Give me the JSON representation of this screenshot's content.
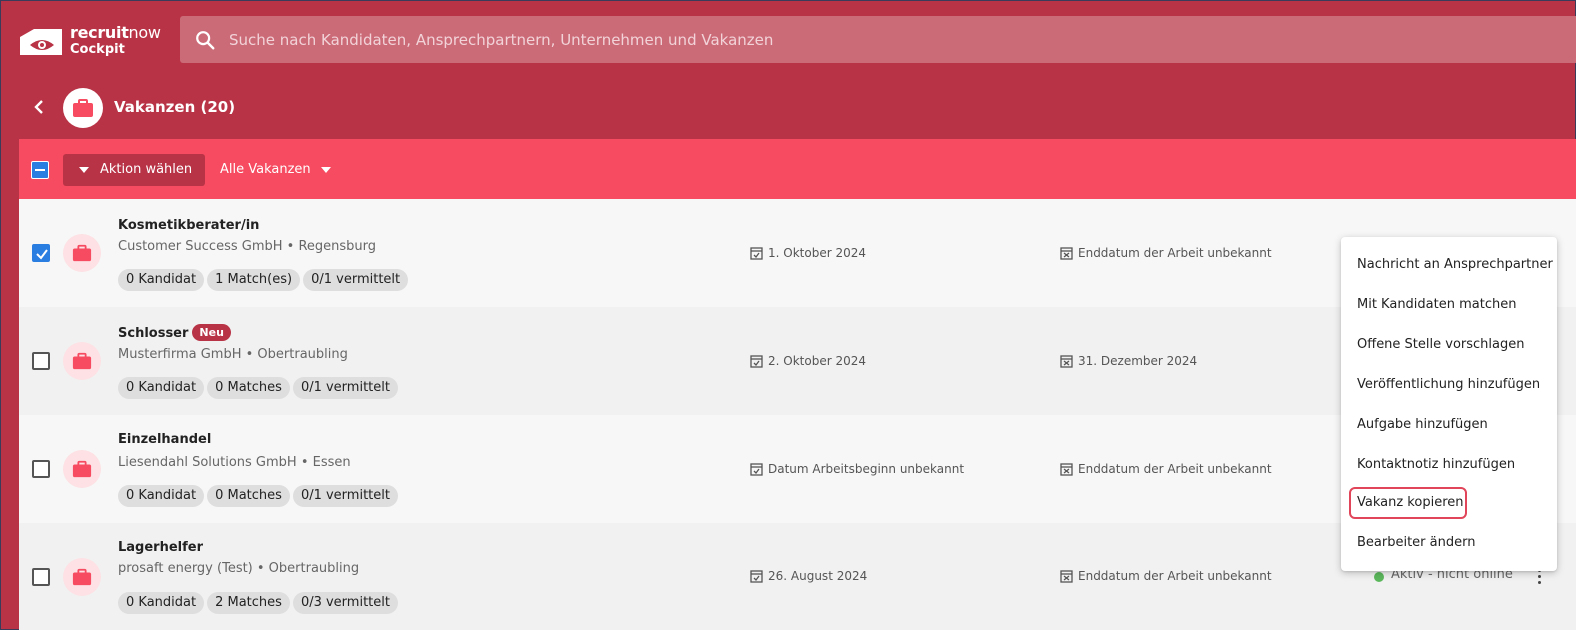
{
  "app": {
    "logo_line1_bold": "recruit",
    "logo_line1_light": "now",
    "logo_line2": "Cockpit"
  },
  "search": {
    "placeholder": "Suche nach Kandidaten, Ansprechpartnern, Unternehmen und Vakanzen",
    "value": ""
  },
  "header": {
    "title": "Vakanzen (20)"
  },
  "actionbar": {
    "action_label": "Aktion wählen",
    "filter_label": "Alle Vakanzen"
  },
  "rows": [
    {
      "title": "Kosmetikberater/in",
      "badge": "",
      "subtitle": "Customer Success GmbH • Regensburg",
      "chips": [
        "0 Kandidat",
        "1 Match(es)",
        "0/1 vermittelt"
      ],
      "start_date": "1. Oktober 2024",
      "end_date": "Enddatum der Arbeit unbekannt",
      "status": "",
      "checked": true
    },
    {
      "title": "Schlosser",
      "badge": "Neu",
      "subtitle": "Musterfirma GmbH • Obertraubling",
      "chips": [
        "0 Kandidat",
        "0 Matches",
        "0/1 vermittelt"
      ],
      "start_date": "2. Oktober 2024",
      "end_date": "31. Dezember 2024",
      "status": "",
      "checked": false
    },
    {
      "title": "Einzelhandel",
      "badge": "",
      "subtitle": "Liesendahl Solutions GmbH • Essen",
      "chips": [
        "0 Kandidat",
        "0 Matches",
        "0/1 vermittelt"
      ],
      "start_date": "Datum Arbeitsbeginn unbekannt",
      "end_date": "Enddatum der Arbeit unbekannt",
      "status": "",
      "checked": false
    },
    {
      "title": "Lagerhelfer",
      "badge": "",
      "subtitle": "prosaft energy (Test) • Obertraubling",
      "chips": [
        "0 Kandidat",
        "2 Matches",
        "0/3 vermittelt"
      ],
      "start_date": "26. August 2024",
      "end_date": "Enddatum der Arbeit unbekannt",
      "status": "Aktiv - nicht online",
      "checked": false
    }
  ],
  "menu": {
    "items": [
      "Nachricht an Ansprechpartner",
      "Mit Kandidaten matchen",
      "Offene Stelle vorschlagen",
      "Veröffentlichung hinzufügen",
      "Aufgabe hinzufügen",
      "Kontaktnotiz hinzufügen",
      "Vakanz kopieren",
      "Bearbeiter ändern"
    ],
    "highlighted_item": "Vakanz kopieren"
  },
  "colors": {
    "topbar": "#b83346",
    "actionbar": "#f64b60",
    "accent_blue": "#2a7de1",
    "status_green": "#5cb85c"
  }
}
